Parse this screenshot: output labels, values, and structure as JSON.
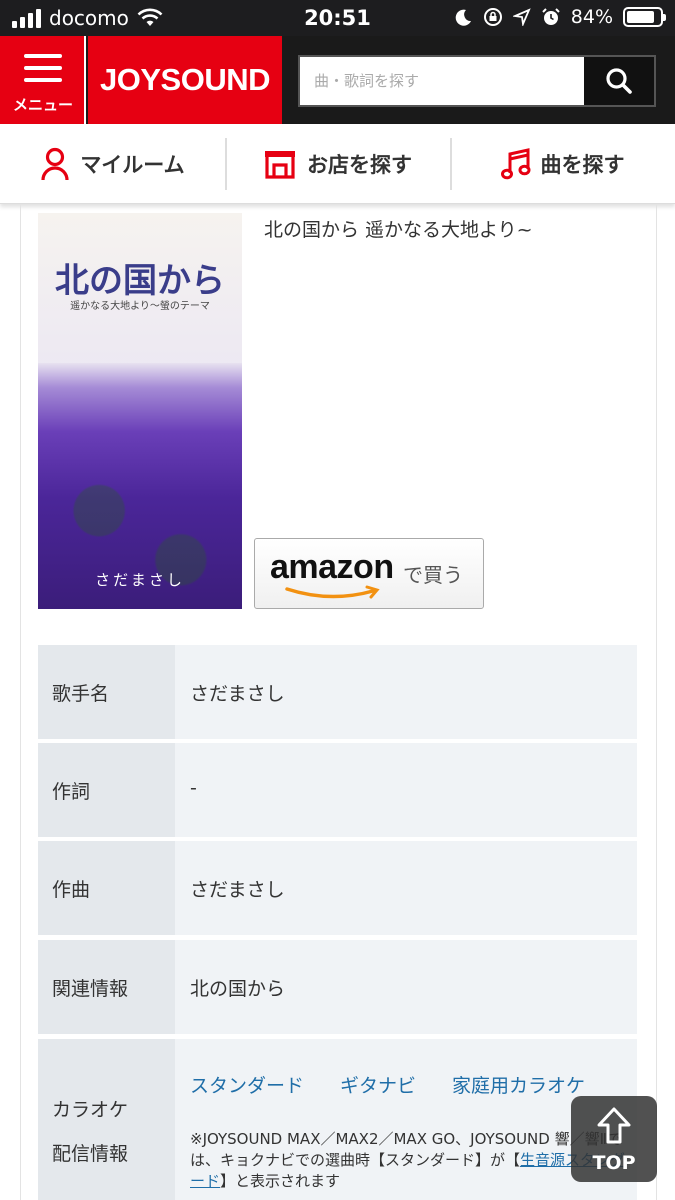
{
  "status_bar": {
    "carrier": "docomo",
    "time": "20:51",
    "battery": "84%",
    "battery_level": 0.84
  },
  "header": {
    "menu_label": "メニュー",
    "logo": "JOYSOUND",
    "search": {
      "placeholder": "曲・歌詞を探す",
      "value": ""
    }
  },
  "nav": {
    "items": [
      {
        "label": "マイルーム",
        "icon": "person-icon"
      },
      {
        "label": "お店を探す",
        "icon": "store-icon"
      },
      {
        "label": "曲を探す",
        "icon": "music-note-icon"
      }
    ]
  },
  "song": {
    "title": "北の国から 遥かなる大地より~",
    "jacket": {
      "title_text": "北の国から",
      "subtitle_text": "遥かなる大地より～螢のテーマ",
      "artist_text": "さだまさし"
    },
    "amazon_button": {
      "logo": "amazon",
      "suffix": "で買う"
    }
  },
  "info": {
    "artist": {
      "key": "歌手名",
      "value": "さだまさし"
    },
    "lyricist": {
      "key": "作詞",
      "value": "-"
    },
    "composer": {
      "key": "作曲",
      "value": "さだまさし"
    },
    "related": {
      "key": "関連情報",
      "value": "北の国から"
    },
    "karaoke": {
      "key_line1": "カラオケ",
      "key_line2": "配信情報",
      "links": [
        "スタンダード",
        "ギタナビ",
        "家庭用カラオケ"
      ],
      "note_pre": "※JOYSOUND MAX／MAX2／MAX GO、JOYSOUND 響／響Ⅱでは、キョクナビでの選曲時【スタンダード】が【",
      "note_link": "生音源スタンダード",
      "note_post": "】と表示されます"
    }
  },
  "top_button": {
    "label": "TOP"
  }
}
